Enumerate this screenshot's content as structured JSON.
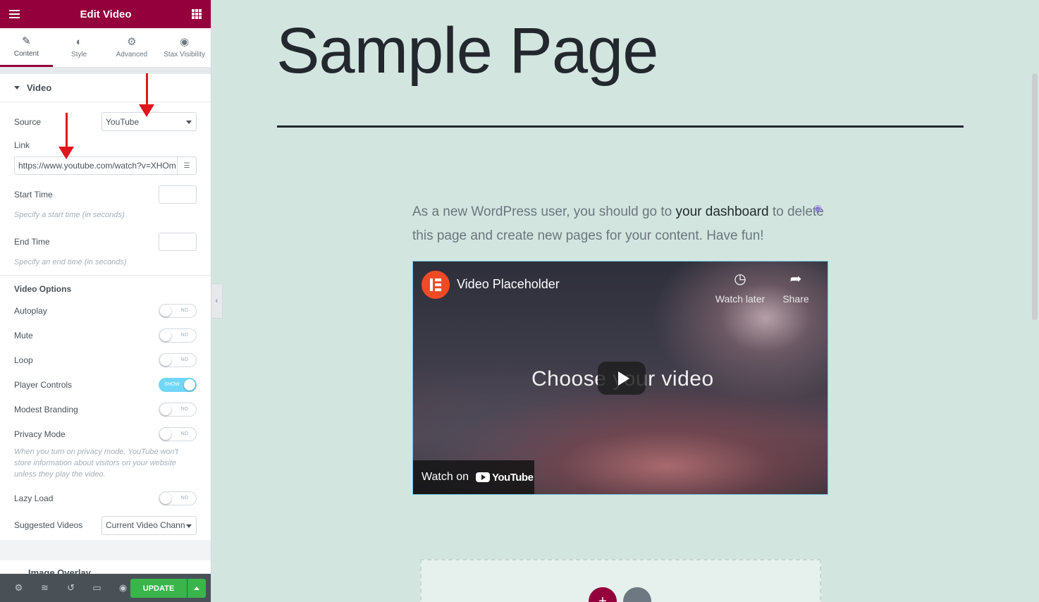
{
  "panel": {
    "title": "Edit Video",
    "tabs": [
      {
        "label": "Content",
        "icon": "pencil-icon"
      },
      {
        "label": "Style",
        "icon": "half-circle-icon"
      },
      {
        "label": "Advanced",
        "icon": "gear-icon"
      },
      {
        "label": "Stax Visibility",
        "icon": "eye-icon"
      }
    ],
    "section_title": "Video",
    "source": {
      "label": "Source",
      "value": "YouTube"
    },
    "link": {
      "label": "Link",
      "value": "https://www.youtube.com/watch?v=XHOm"
    },
    "start_time": {
      "label": "Start Time",
      "help": "Specify a start time (in seconds)"
    },
    "end_time": {
      "label": "End Time",
      "help": "Specify an end time (in seconds)"
    },
    "options_title": "Video Options",
    "toggles": [
      {
        "label": "Autoplay",
        "state": "NO"
      },
      {
        "label": "Mute",
        "state": "NO"
      },
      {
        "label": "Loop",
        "state": "NO"
      },
      {
        "label": "Player Controls",
        "state": "SHOW"
      },
      {
        "label": "Modest Branding",
        "state": "NO"
      },
      {
        "label": "Privacy Mode",
        "state": "NO"
      }
    ],
    "privacy_help": "When you turn on privacy mode, YouTube won't store information about visitors on your website unless they play the video.",
    "lazy_load": {
      "label": "Lazy Load",
      "state": "NO"
    },
    "suggested": {
      "label": "Suggested Videos",
      "value": "Current Video Chann"
    },
    "overlay_section": "Image Overlay",
    "update_label": "UPDATE"
  },
  "canvas": {
    "page_title": "Sample Page",
    "intro_before": "As a new WordPress user, you should go to ",
    "intro_link": "your dashboard",
    "intro_after": " to delete this page and create new pages for your content. Have fun!",
    "video": {
      "title": "Video Placeholder",
      "watch_later": "Watch later",
      "share": "Share",
      "center_text": "Choose your video",
      "watch_on": "Watch on",
      "youtube": "YouTube"
    },
    "add_symbol": "+"
  },
  "colors": {
    "accent": "#93003c",
    "update": "#39b54a",
    "canvas_bg": "#d3e5df"
  }
}
